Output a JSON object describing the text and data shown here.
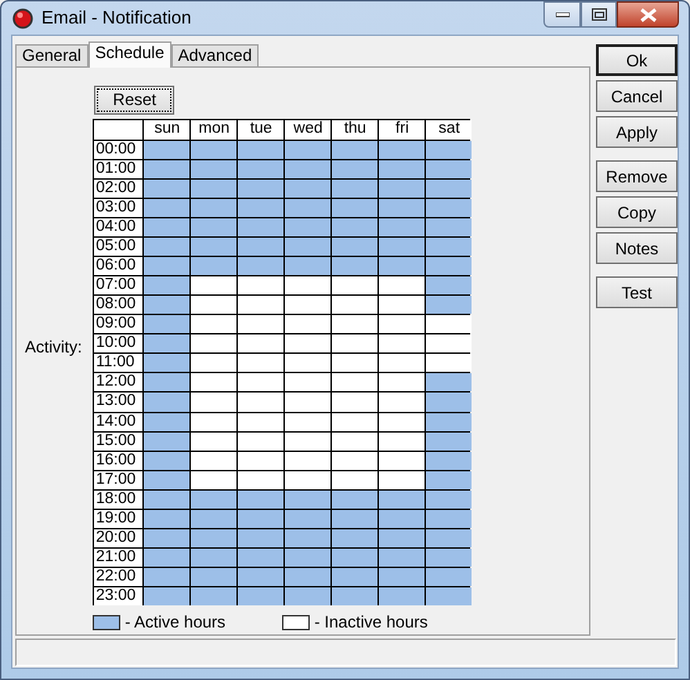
{
  "window": {
    "title": "Email - Notification"
  },
  "tabs": [
    {
      "label": "General",
      "selected": false
    },
    {
      "label": "Schedule",
      "selected": true
    },
    {
      "label": "Advanced",
      "selected": false
    }
  ],
  "reset_button": "Reset",
  "activity_label": "Activity:",
  "schedule": {
    "days": [
      "sun",
      "mon",
      "tue",
      "wed",
      "thu",
      "fri",
      "sat"
    ],
    "rows": [
      {
        "hour": "00:00",
        "active": [
          true,
          true,
          true,
          true,
          true,
          true,
          true
        ]
      },
      {
        "hour": "01:00",
        "active": [
          true,
          true,
          true,
          true,
          true,
          true,
          true
        ]
      },
      {
        "hour": "02:00",
        "active": [
          true,
          true,
          true,
          true,
          true,
          true,
          true
        ]
      },
      {
        "hour": "03:00",
        "active": [
          true,
          true,
          true,
          true,
          true,
          true,
          true
        ]
      },
      {
        "hour": "04:00",
        "active": [
          true,
          true,
          true,
          true,
          true,
          true,
          true
        ]
      },
      {
        "hour": "05:00",
        "active": [
          true,
          true,
          true,
          true,
          true,
          true,
          true
        ]
      },
      {
        "hour": "06:00",
        "active": [
          true,
          true,
          true,
          true,
          true,
          true,
          true
        ]
      },
      {
        "hour": "07:00",
        "active": [
          true,
          false,
          false,
          false,
          false,
          false,
          true
        ]
      },
      {
        "hour": "08:00",
        "active": [
          true,
          false,
          false,
          false,
          false,
          false,
          true
        ]
      },
      {
        "hour": "09:00",
        "active": [
          true,
          false,
          false,
          false,
          false,
          false,
          false
        ]
      },
      {
        "hour": "10:00",
        "active": [
          true,
          false,
          false,
          false,
          false,
          false,
          false
        ]
      },
      {
        "hour": "11:00",
        "active": [
          true,
          false,
          false,
          false,
          false,
          false,
          false
        ]
      },
      {
        "hour": "12:00",
        "active": [
          true,
          false,
          false,
          false,
          false,
          false,
          true
        ]
      },
      {
        "hour": "13:00",
        "active": [
          true,
          false,
          false,
          false,
          false,
          false,
          true
        ]
      },
      {
        "hour": "14:00",
        "active": [
          true,
          false,
          false,
          false,
          false,
          false,
          true
        ]
      },
      {
        "hour": "15:00",
        "active": [
          true,
          false,
          false,
          false,
          false,
          false,
          true
        ]
      },
      {
        "hour": "16:00",
        "active": [
          true,
          false,
          false,
          false,
          false,
          false,
          true
        ]
      },
      {
        "hour": "17:00",
        "active": [
          true,
          false,
          false,
          false,
          false,
          false,
          true
        ]
      },
      {
        "hour": "18:00",
        "active": [
          true,
          true,
          true,
          true,
          true,
          true,
          true
        ]
      },
      {
        "hour": "19:00",
        "active": [
          true,
          true,
          true,
          true,
          true,
          true,
          true
        ]
      },
      {
        "hour": "20:00",
        "active": [
          true,
          true,
          true,
          true,
          true,
          true,
          true
        ]
      },
      {
        "hour": "21:00",
        "active": [
          true,
          true,
          true,
          true,
          true,
          true,
          true
        ]
      },
      {
        "hour": "22:00",
        "active": [
          true,
          true,
          true,
          true,
          true,
          true,
          true
        ]
      },
      {
        "hour": "23:00",
        "active": [
          true,
          true,
          true,
          true,
          true,
          true,
          true
        ]
      }
    ]
  },
  "legend": [
    {
      "label": "- Active hours",
      "active": true
    },
    {
      "label": "- Inactive hours",
      "active": false
    }
  ],
  "button_groups": [
    [
      {
        "label": "Ok",
        "default": true
      },
      {
        "label": "Cancel",
        "default": false
      },
      {
        "label": "Apply",
        "default": false
      }
    ],
    [
      {
        "label": "Remove",
        "default": false
      },
      {
        "label": "Copy",
        "default": false
      },
      {
        "label": "Notes",
        "default": false
      }
    ],
    [
      {
        "label": "Test",
        "default": false
      }
    ]
  ]
}
